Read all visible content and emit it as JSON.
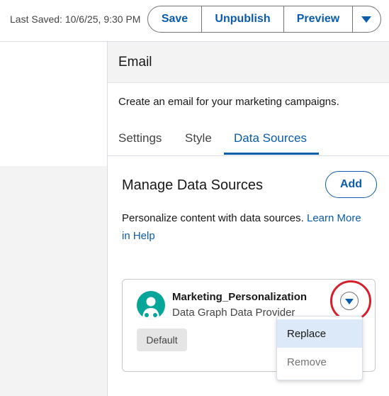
{
  "header": {
    "last_saved": "Last Saved: 10/6/25, 9:30 PM",
    "save_label": "Save",
    "unpublish_label": "Unpublish",
    "preview_label": "Preview",
    "more_icon": "chevron-down-icon"
  },
  "panel": {
    "title": "Email",
    "description": "Create an email for your marketing campaigns.",
    "tabs": [
      {
        "label": "Settings",
        "active": false
      },
      {
        "label": "Style",
        "active": false
      },
      {
        "label": "Data Sources",
        "active": true
      }
    ],
    "section_title": "Manage Data Sources",
    "add_label": "Add",
    "help_text": "Personalize content with data sources. ",
    "help_link": "Learn More in Help"
  },
  "card": {
    "name": "Marketing_Personalization",
    "subtitle": "Data Graph Data Provider",
    "badge": "Default",
    "icon": "users-icon",
    "menu_icon": "chevron-down-icon"
  },
  "dropdown": {
    "items": [
      {
        "label": "Replace",
        "highlighted": true
      },
      {
        "label": "Remove",
        "highlighted": false
      }
    ]
  },
  "colors": {
    "brand": "#0b5cab",
    "icon_bg": "#06a59a",
    "highlight_ring": "#d41f2d"
  }
}
